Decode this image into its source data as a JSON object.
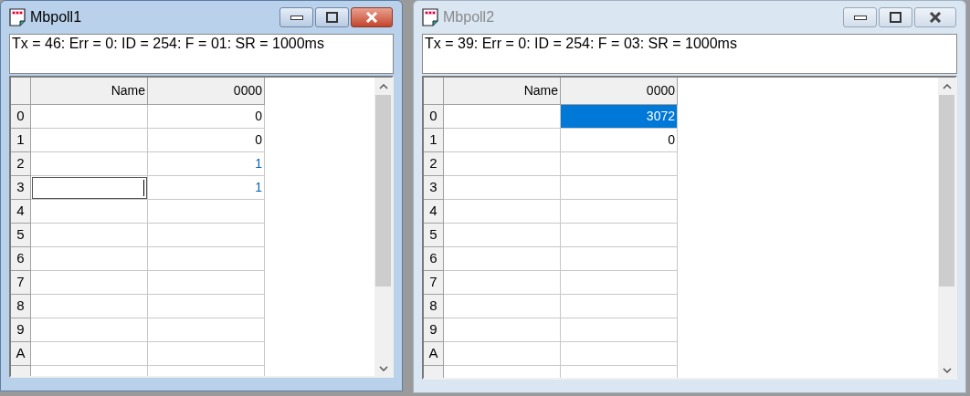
{
  "windows": [
    {
      "title": "Mbpoll1",
      "active": true,
      "status": "Tx = 46: Err = 0: ID = 254: F = 01: SR = 1000ms",
      "columns": [
        "Name",
        "0000"
      ],
      "rows": [
        {
          "header": "0",
          "value": "0",
          "selected": false,
          "updated": false,
          "editing": false
        },
        {
          "header": "1",
          "value": "0",
          "selected": false,
          "updated": false,
          "editing": false
        },
        {
          "header": "2",
          "value": "1",
          "selected": false,
          "updated": true,
          "editing": false
        },
        {
          "header": "3",
          "value": "1",
          "selected": false,
          "updated": true,
          "editing": true
        },
        {
          "header": "4",
          "selected": false,
          "editing": false
        },
        {
          "header": "5",
          "selected": false,
          "editing": false
        },
        {
          "header": "6",
          "selected": false,
          "editing": false
        },
        {
          "header": "7",
          "selected": false,
          "editing": false
        },
        {
          "header": "8",
          "selected": false,
          "editing": false
        },
        {
          "header": "9",
          "selected": false,
          "editing": false
        },
        {
          "header": "A",
          "selected": false,
          "editing": false
        },
        {
          "selected": false,
          "editing": false
        }
      ]
    },
    {
      "title": "Mbpoll2",
      "active": false,
      "status": "Tx = 39: Err = 0: ID = 254: F = 03: SR = 1000ms",
      "columns": [
        "Name",
        "0000"
      ],
      "rows": [
        {
          "header": "0",
          "value": "3072",
          "selected": true,
          "editing": false
        },
        {
          "header": "1",
          "value": "0",
          "selected": false,
          "updated": false,
          "editing": false
        },
        {
          "header": "2",
          "selected": false,
          "editing": false
        },
        {
          "header": "3",
          "selected": false,
          "editing": false
        },
        {
          "header": "4",
          "selected": false,
          "editing": false
        },
        {
          "header": "5",
          "selected": false,
          "editing": false
        },
        {
          "header": "6",
          "selected": false,
          "editing": false
        },
        {
          "header": "7",
          "selected": false,
          "editing": false
        },
        {
          "header": "8",
          "selected": false,
          "editing": false
        },
        {
          "header": "9",
          "selected": false,
          "editing": false
        },
        {
          "header": "A",
          "selected": false,
          "editing": false
        },
        {
          "selected": false,
          "editing": false
        }
      ]
    }
  ]
}
